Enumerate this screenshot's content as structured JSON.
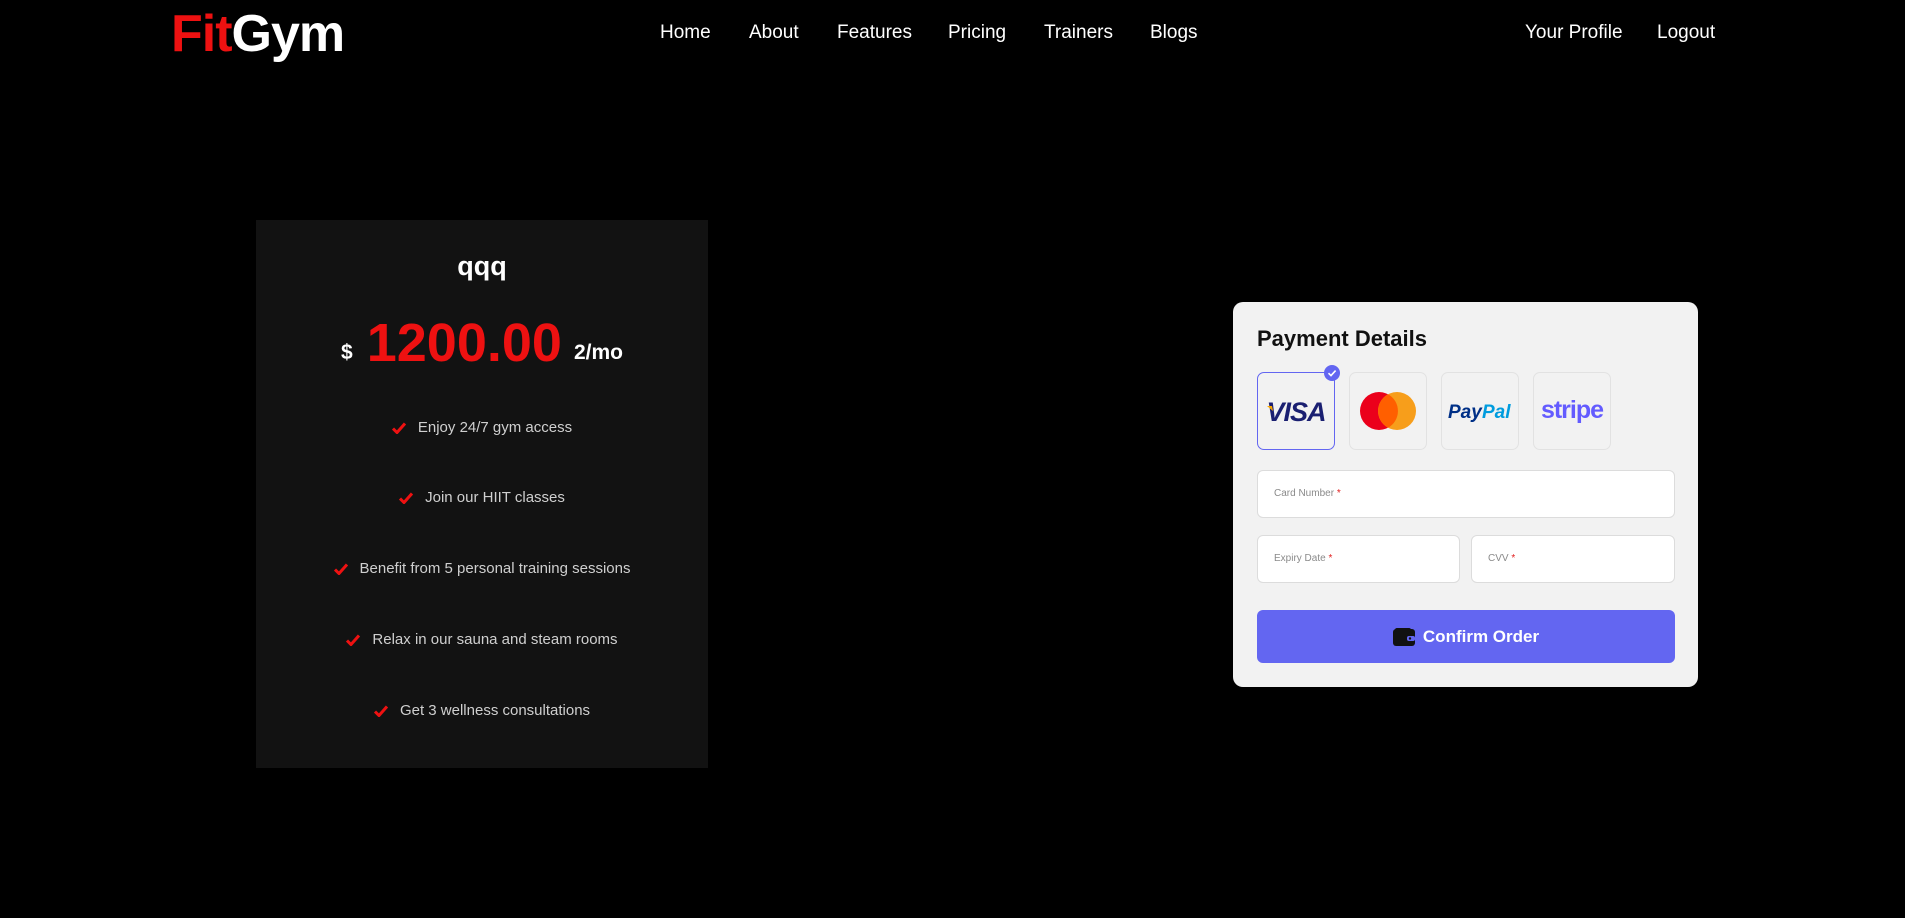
{
  "header": {
    "logo_part1": "Fit",
    "logo_part2": "Gym",
    "nav": [
      "Home",
      "About",
      "Features",
      "Pricing",
      "Trainers",
      "Blogs"
    ],
    "account": [
      "Your Profile",
      "Logout"
    ]
  },
  "plan": {
    "name": "qqq",
    "currency": "$",
    "price": "1200.00",
    "period": "2/mo",
    "features": [
      "Enjoy 24/7 gym access",
      "Join our HIIT classes",
      "Benefit from 5 personal training sessions",
      "Relax in our sauna and steam rooms",
      "Get 3 wellness consultations"
    ]
  },
  "payment": {
    "title": "Payment Details",
    "methods": [
      {
        "name": "VISA",
        "icon": "visa-logo",
        "selected": true
      },
      {
        "name": "Mastercard",
        "icon": "mastercard-logo",
        "selected": false
      },
      {
        "name": "PayPal",
        "icon": "paypal-logo",
        "selected": false
      },
      {
        "name": "stripe",
        "icon": "stripe-logo",
        "selected": false
      }
    ],
    "card_number_label": "Card Number",
    "expiry_label": "Expiry Date",
    "cvv_label": "CVV",
    "required_marker": "*",
    "confirm_label": "Confirm Order"
  },
  "colors": {
    "brand_red": "#ee1111",
    "accent": "#6366f1",
    "background": "#000000",
    "card": "#121212",
    "panel": "#f2f2f2"
  }
}
